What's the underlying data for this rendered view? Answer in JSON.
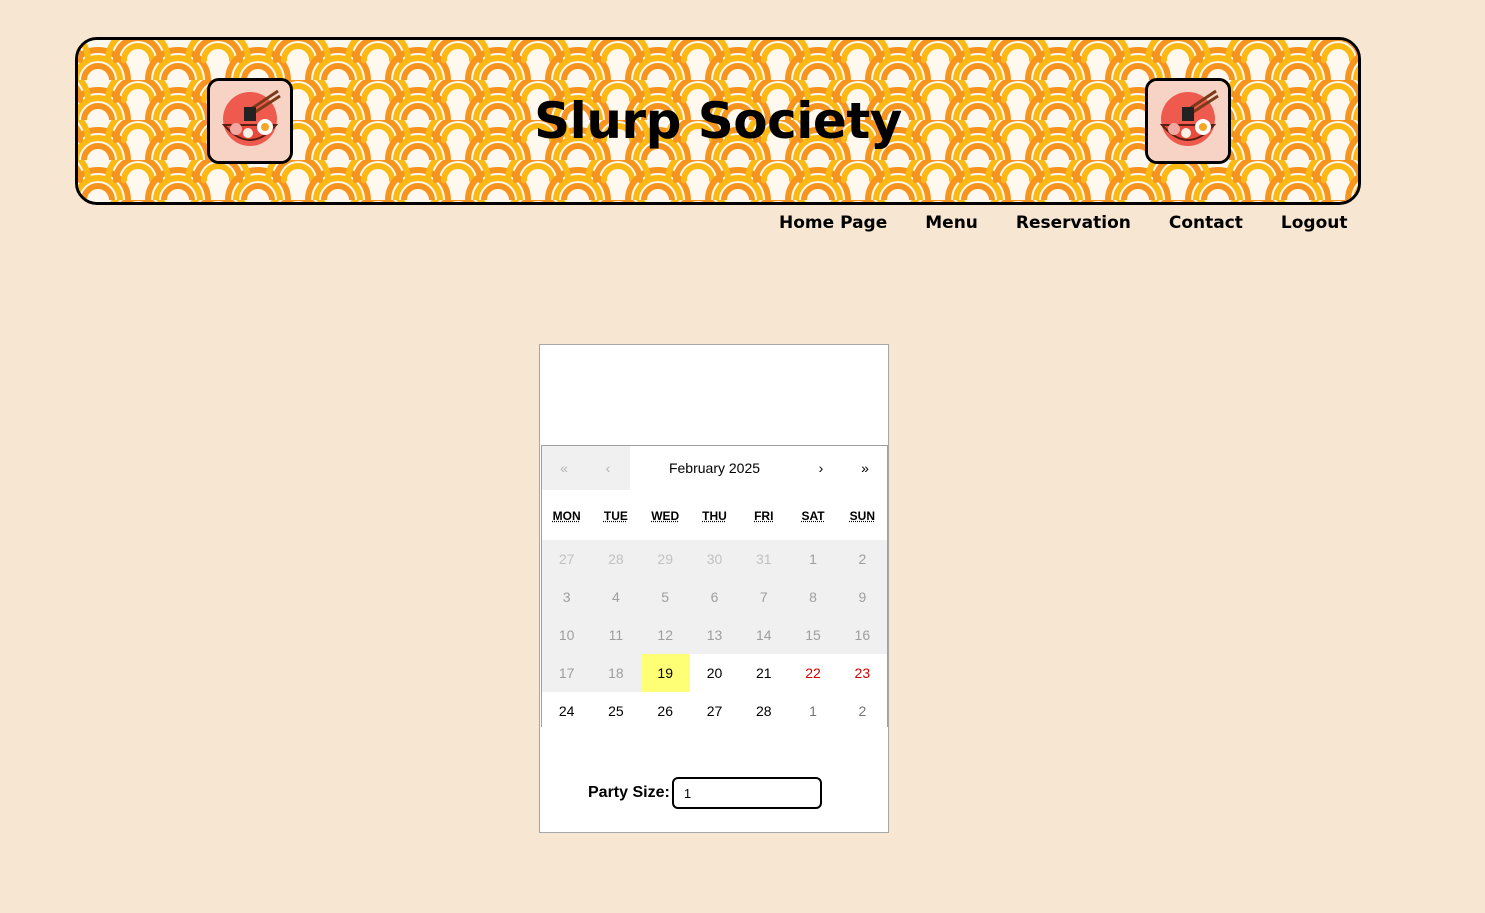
{
  "site": {
    "title": "Slurp Society"
  },
  "nav": {
    "items": [
      "Home Page",
      "Menu",
      "Reservation",
      "Contact",
      "Logout"
    ]
  },
  "calendar": {
    "month_label": "February 2025",
    "prev_year": "«",
    "prev_month": "‹",
    "next_month": "›",
    "next_year": "»",
    "weekdays": [
      "MON",
      "TUE",
      "WED",
      "THU",
      "FRI",
      "SAT",
      "SUN"
    ],
    "days": [
      {
        "label": "27",
        "state": "past",
        "other_month": true
      },
      {
        "label": "28",
        "state": "past",
        "other_month": true
      },
      {
        "label": "29",
        "state": "past",
        "other_month": true
      },
      {
        "label": "30",
        "state": "past",
        "other_month": true
      },
      {
        "label": "31",
        "state": "past",
        "other_month": true
      },
      {
        "label": "1",
        "state": "past",
        "other_month": false
      },
      {
        "label": "2",
        "state": "past",
        "other_month": false
      },
      {
        "label": "3",
        "state": "past",
        "other_month": false
      },
      {
        "label": "4",
        "state": "past",
        "other_month": false
      },
      {
        "label": "5",
        "state": "past",
        "other_month": false
      },
      {
        "label": "6",
        "state": "past",
        "other_month": false
      },
      {
        "label": "7",
        "state": "past",
        "other_month": false
      },
      {
        "label": "8",
        "state": "past",
        "other_month": false
      },
      {
        "label": "9",
        "state": "past",
        "other_month": false
      },
      {
        "label": "10",
        "state": "past",
        "other_month": false
      },
      {
        "label": "11",
        "state": "past",
        "other_month": false
      },
      {
        "label": "12",
        "state": "past",
        "other_month": false
      },
      {
        "label": "13",
        "state": "past",
        "other_month": false
      },
      {
        "label": "14",
        "state": "past",
        "other_month": false
      },
      {
        "label": "15",
        "state": "past",
        "other_month": false
      },
      {
        "label": "16",
        "state": "past",
        "other_month": false
      },
      {
        "label": "17",
        "state": "past",
        "other_month": false
      },
      {
        "label": "18",
        "state": "past",
        "other_month": false
      },
      {
        "label": "19",
        "state": "today",
        "other_month": false
      },
      {
        "label": "20",
        "state": "future",
        "other_month": false
      },
      {
        "label": "21",
        "state": "future",
        "other_month": false
      },
      {
        "label": "22",
        "state": "future",
        "other_month": false,
        "weekend": true
      },
      {
        "label": "23",
        "state": "future",
        "other_month": false,
        "weekend": true
      },
      {
        "label": "24",
        "state": "future",
        "other_month": false
      },
      {
        "label": "25",
        "state": "future",
        "other_month": false
      },
      {
        "label": "26",
        "state": "future",
        "other_month": false
      },
      {
        "label": "27",
        "state": "future",
        "other_month": false
      },
      {
        "label": "28",
        "state": "future",
        "other_month": false
      },
      {
        "label": "1",
        "state": "future",
        "other_month": true
      },
      {
        "label": "2",
        "state": "future",
        "other_month": true
      }
    ]
  },
  "party": {
    "label": "Party Size:",
    "value": "1"
  },
  "colors": {
    "page_background": "#f7e6d1",
    "noodle_orange": "#f7941d",
    "noodle_yellow": "#fdb913",
    "today_highlight": "#ffff76",
    "weekend_red": "#d10000"
  },
  "icons": {
    "logo": "ramen-bowl-icon"
  }
}
